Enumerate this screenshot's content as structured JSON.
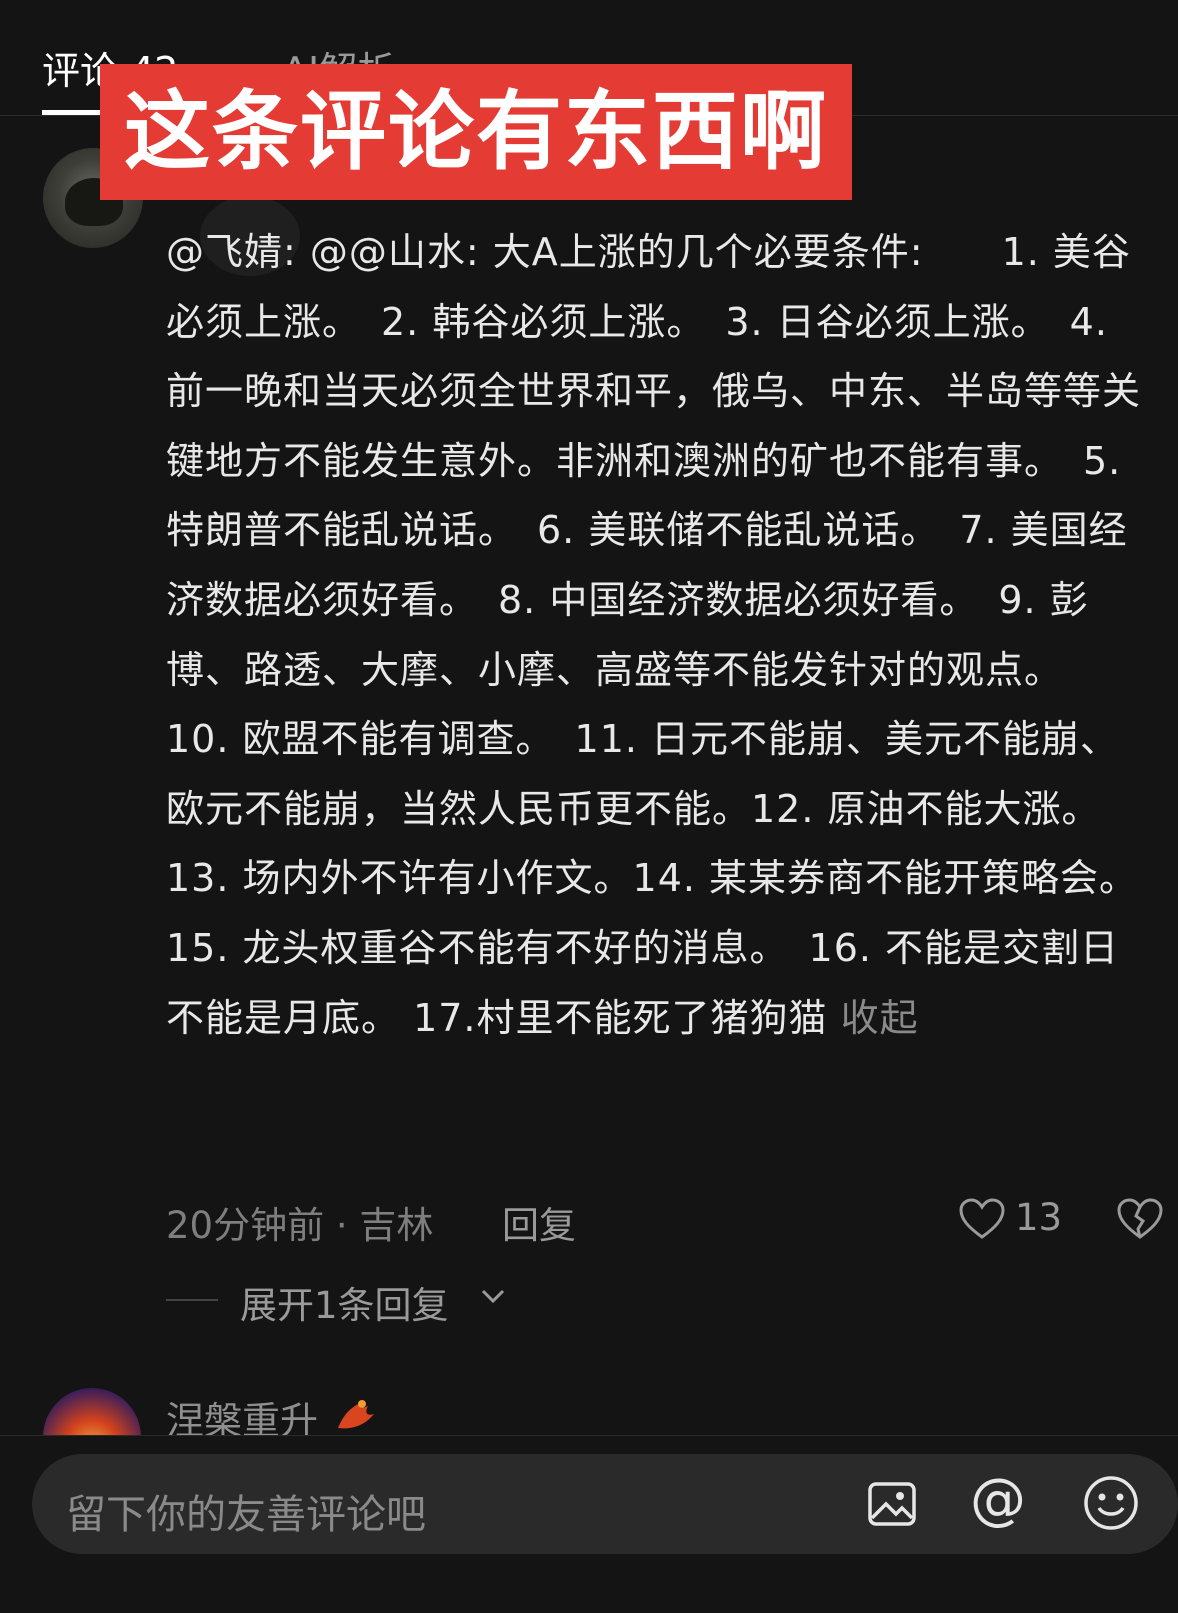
{
  "tabs": {
    "comments": "评论 42",
    "ai": "AI解析"
  },
  "overlay": {
    "banner": "这条评论有东西啊"
  },
  "comment": {
    "text": "@飞婧: @@山水: 大A上涨的几个必要条件:　　1. 美谷必须上涨。　2. 韩谷必须上涨。　3. 日谷必须上涨。　4. 前一晚和当天必须全世界和平，俄乌、中东、半岛等等关键地方不能发生意外。非洲和澳洲的矿也不能有事。　5. 特朗普不能乱说话。　6. 美联储不能乱说话。　7. 美国经济数据必须好看。　8. 中国经济数据必须好看。　9. 彭博、路透、大摩、小摩、高盛等不能发针对的观点。　10. 欧盟不能有调查。　11. 日元不能崩、美元不能崩、欧元不能崩，当然人民币更不能。12. 原油不能大涨。　13. 场内外不许有小作文。14. 某某券商不能开策略会。　15. 龙头权重谷不能有不好的消息。　16. 不能是交割日 不能是月底。 17.村里不能死了猪狗猫",
    "collapse": "收起",
    "meta": "20分钟前 · 吉林",
    "reply": "回复",
    "likes": "13",
    "expand": "展开1条回复"
  },
  "next_comment": {
    "username": "涅槃重升"
  },
  "input": {
    "placeholder": "留下你的友善评论吧"
  },
  "icons": {
    "heart": "heart-outline-icon",
    "dislike": "broken-heart-icon",
    "image": "image-icon",
    "at": "at-sign-icon",
    "emoji": "smiley-icon"
  },
  "colors": {
    "background": "#141414",
    "banner": "#e43b35"
  }
}
